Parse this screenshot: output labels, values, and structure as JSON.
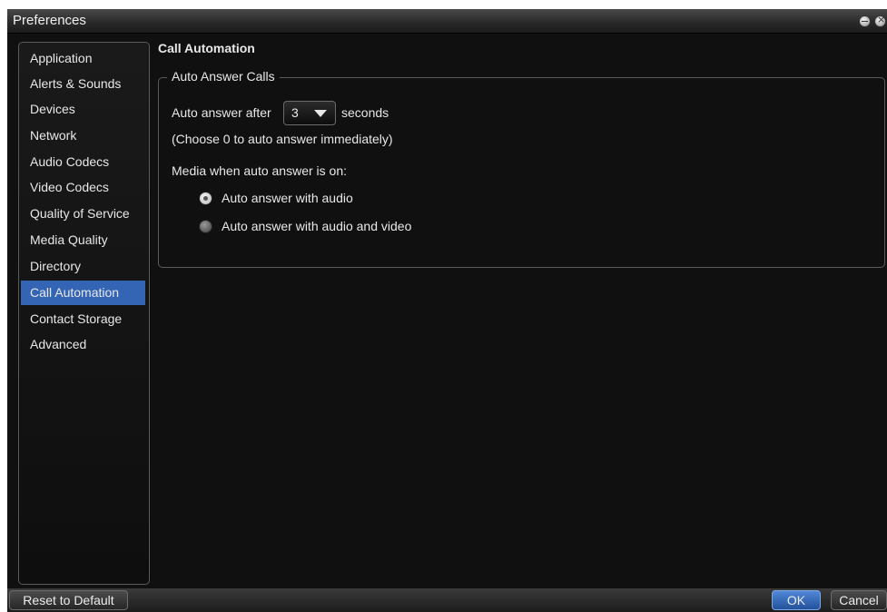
{
  "window": {
    "title": "Preferences"
  },
  "sidebar": {
    "items": [
      {
        "label": "Application"
      },
      {
        "label": "Alerts & Sounds"
      },
      {
        "label": "Devices"
      },
      {
        "label": "Network"
      },
      {
        "label": "Audio Codecs"
      },
      {
        "label": "Video Codecs"
      },
      {
        "label": "Quality of Service"
      },
      {
        "label": "Media Quality"
      },
      {
        "label": "Directory"
      },
      {
        "label": "Call Automation",
        "selected": true
      },
      {
        "label": "Contact Storage"
      },
      {
        "label": "Advanced"
      }
    ]
  },
  "main": {
    "title": "Call Automation",
    "group": {
      "legend": "Auto Answer Calls",
      "auto_answer_prefix": "Auto answer after",
      "auto_answer_value": "3",
      "auto_answer_suffix": "seconds",
      "hint": "(Choose 0 to auto answer immediately)",
      "media_label": "Media when auto answer is on:",
      "options": [
        {
          "label": "Auto answer with audio",
          "checked": true
        },
        {
          "label": "Auto answer with audio and video",
          "checked": false
        }
      ]
    }
  },
  "footer": {
    "reset_label": "Reset to Default",
    "ok_label": "OK",
    "cancel_label": "Cancel"
  },
  "colors": {
    "selection": "#3464b4",
    "background": "#101010",
    "text": "#e8e8e8"
  }
}
